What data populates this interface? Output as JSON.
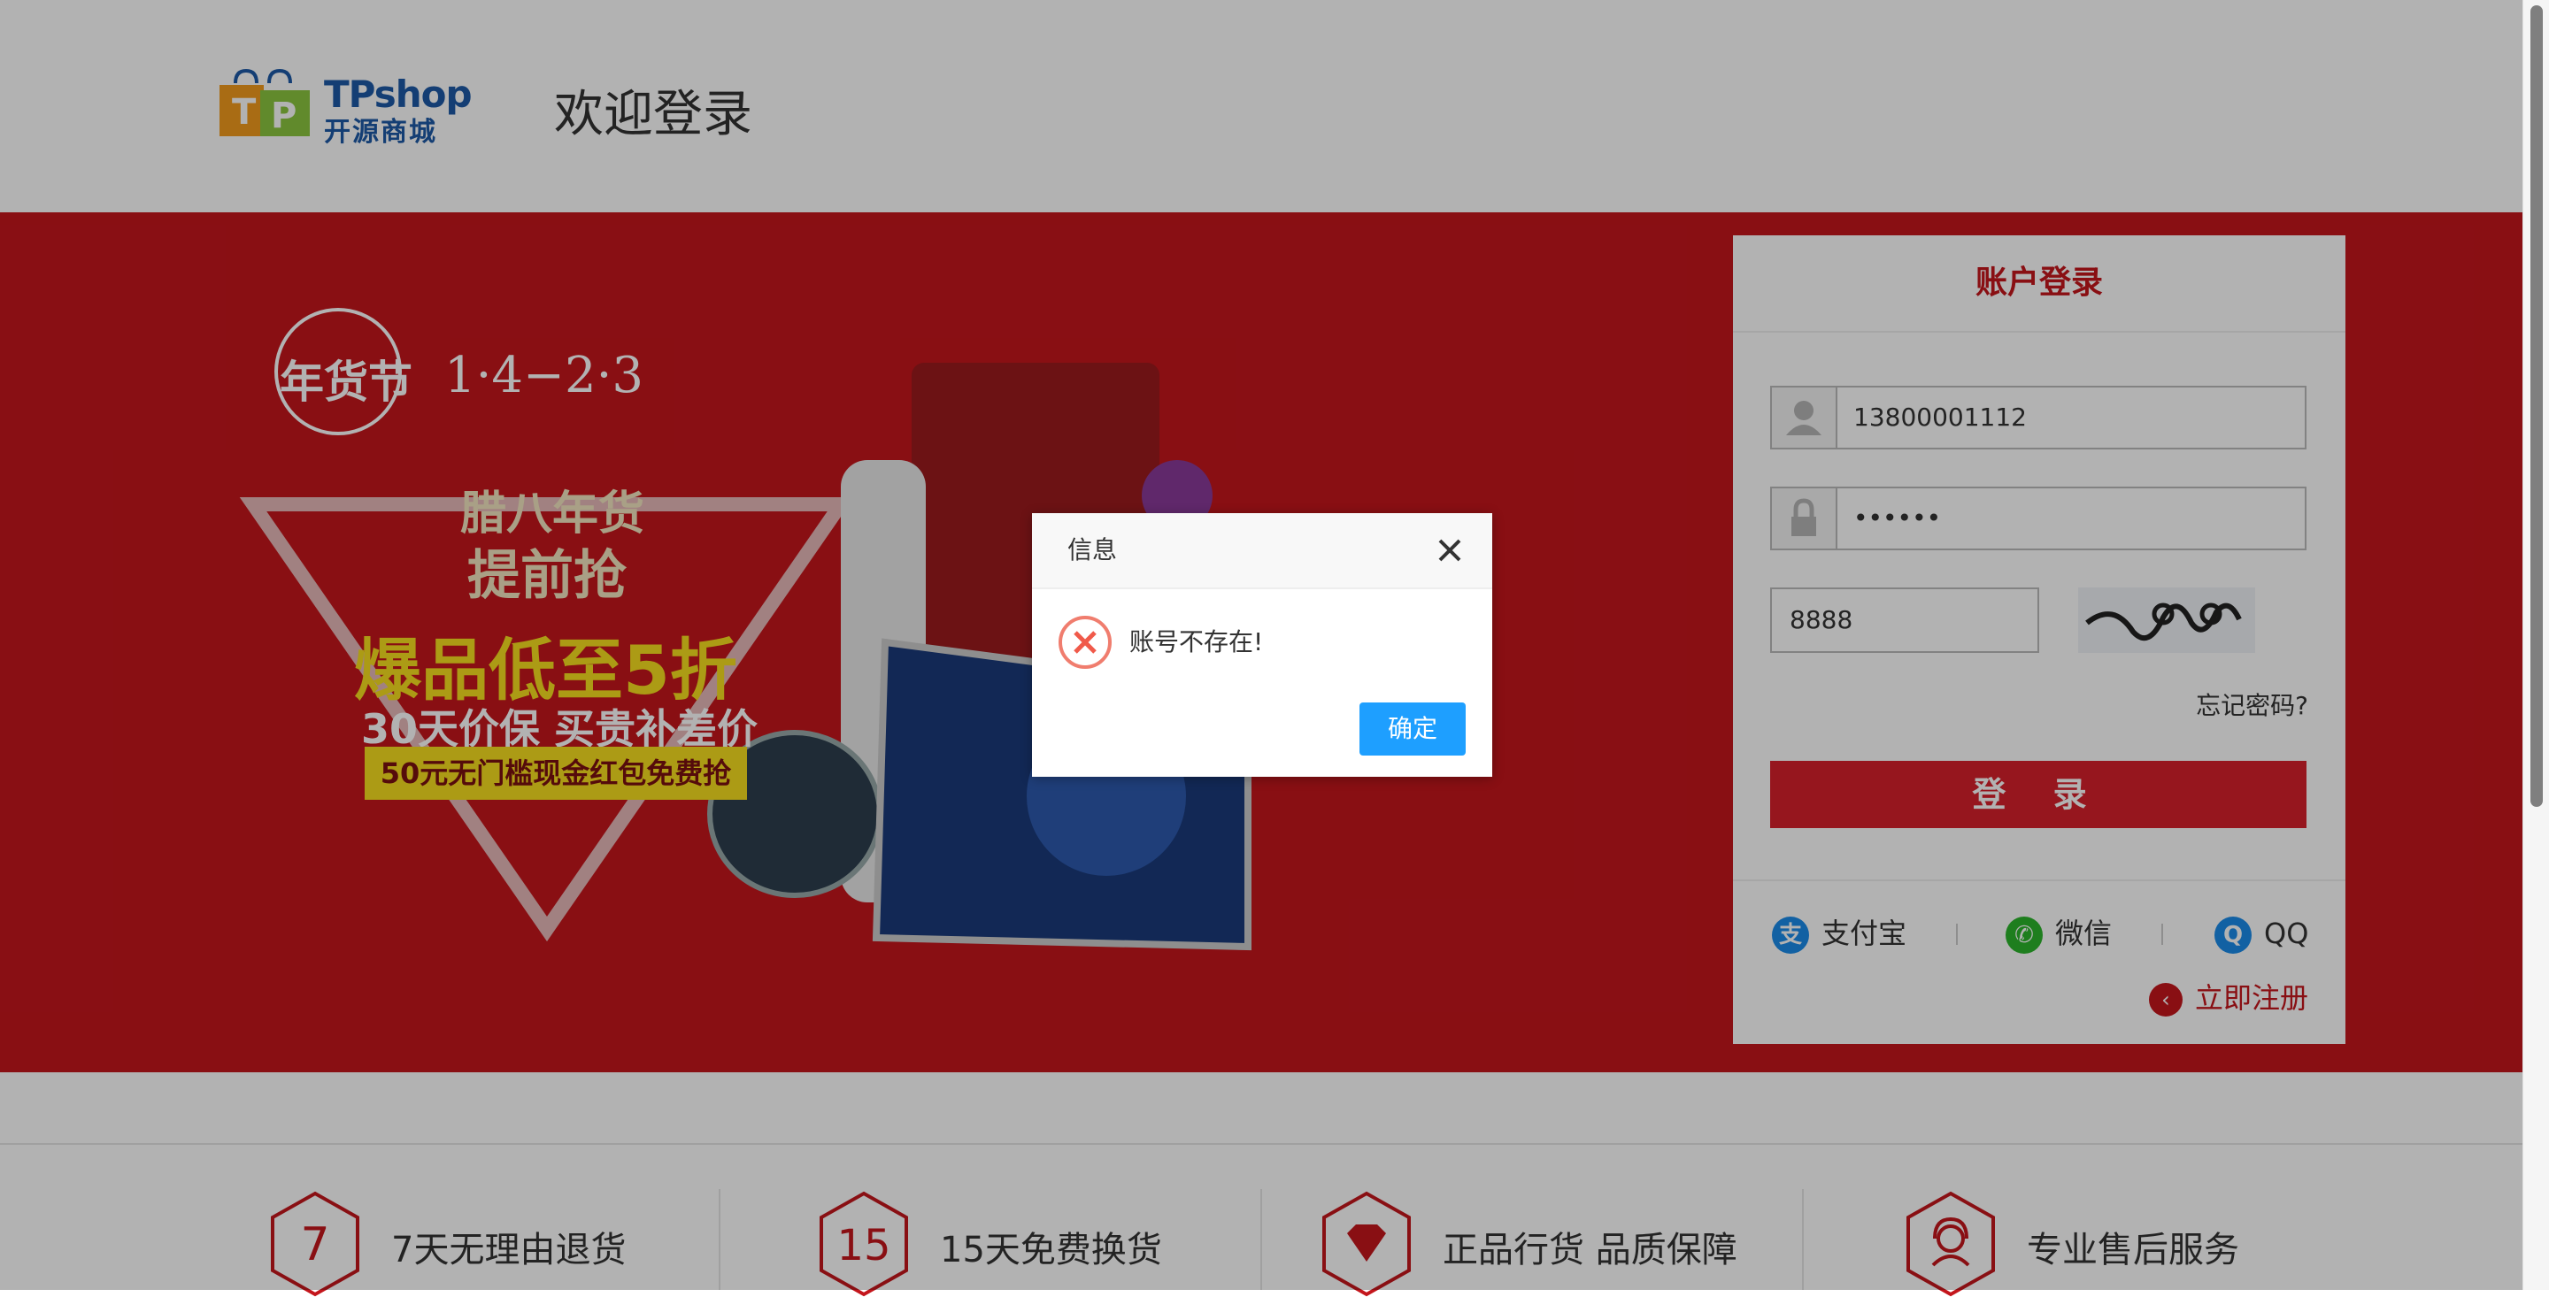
{
  "header": {
    "logo_text": "TPshop",
    "logo_sub": "开源商城",
    "welcome": "欢迎登录"
  },
  "banner": {
    "festival": "年货节",
    "dates": "1·4−2·3",
    "line1": "腊八年货",
    "line2": "提前抢",
    "line3": "爆品低至5折",
    "line4": "30天价保 买贵补差价",
    "line5": "50元无门槛现金红包免费抢"
  },
  "login": {
    "title": "账户登录",
    "username_value": "13800001112",
    "password_value": "••••••",
    "captcha_value": "8888",
    "forgot": "忘记密码?",
    "submit": "登    录",
    "social": [
      {
        "label": "支付宝",
        "icon": "alipay-icon",
        "color": "#1a8bea",
        "glyph": "支"
      },
      {
        "label": "微信",
        "icon": "wechat-icon",
        "color": "#2bb52b",
        "glyph": "✆"
      },
      {
        "label": "QQ",
        "icon": "qq-icon",
        "color": "#1a8bea",
        "glyph": "Q"
      }
    ],
    "register": "立即注册"
  },
  "services": [
    {
      "num": "7",
      "text": "7天无理由退货"
    },
    {
      "num": "15",
      "text": "15天免费换货"
    },
    {
      "num": "",
      "text": "正品行货 品质保障"
    },
    {
      "num": "",
      "text": "专业售后服务"
    }
  ],
  "dialog": {
    "title": "信息",
    "message": "账号不存在!",
    "ok": "确定"
  },
  "colors": {
    "brand_red": "#c4161c",
    "button_blue": "#1e9fff"
  }
}
